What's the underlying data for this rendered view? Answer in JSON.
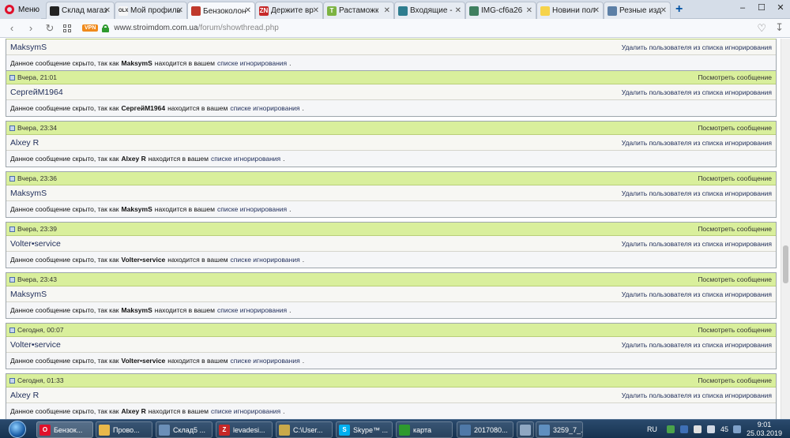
{
  "browser": {
    "menu_label": "Меню",
    "tabs": [
      {
        "label": "Склад магаз",
        "icon": "bookmark-icon",
        "color": "#222222",
        "glyph": ""
      },
      {
        "label": "Мой профиль",
        "icon": "olx-icon",
        "color": "#f7f7f7",
        "glyph": "OLX"
      },
      {
        "label": "Бензоколон",
        "icon": "stroimdom-icon",
        "color": "#c0392b",
        "glyph": ""
      },
      {
        "label": "Держите вр",
        "icon": "zn-icon",
        "color": "#c62828",
        "glyph": "ZN"
      },
      {
        "label": "Растаможк",
        "icon": "t-icon",
        "color": "#7cb342",
        "glyph": "T"
      },
      {
        "label": "Входящие -",
        "icon": "mail-icon",
        "color": "#2e7d8f",
        "glyph": ""
      },
      {
        "label": "IMG-cf6a26",
        "icon": "image-icon",
        "color": "#3f7f5f",
        "glyph": ""
      },
      {
        "label": "Новини пол",
        "icon": "sun-icon",
        "color": "#f6d34a",
        "glyph": ""
      },
      {
        "label": "Резные изд",
        "icon": "carving-icon",
        "color": "#5c7fa6",
        "glyph": ""
      }
    ],
    "new_tab_label": "+",
    "window_controls": [
      "‒",
      "☐",
      "✕"
    ],
    "vpn_badge": "VPN",
    "url_host": "www.stroimdom.com.ua",
    "url_path": "/forum/showthread.php"
  },
  "forum": {
    "view_post_label": "Посмотреть сообщение",
    "unignore_label": "Удалить пользователя из списка игнорирования",
    "hidden_prefix": "Данное сообщение скрыто, так как",
    "hidden_middle": "находится в вашем",
    "ignore_list_link": "списке игнорирования",
    "hidden_suffix": ".",
    "first_partial": {
      "username": "MaksymS"
    },
    "posts": [
      {
        "date": "Вчера, 21:01",
        "username": "СергейМ1964"
      },
      {
        "date": "Вчера, 23:34",
        "username": "Alxey R"
      },
      {
        "date": "Вчера, 23:36",
        "username": "MaksymS"
      },
      {
        "date": "Вчера, 23:39",
        "username": "Volter•service"
      },
      {
        "date": "Вчера, 23:43",
        "username": "MaksymS"
      },
      {
        "date": "Сегодня, 00:07",
        "username": "Volter•service"
      },
      {
        "date": "Сегодня, 01:33",
        "username": "Alxey R"
      }
    ]
  },
  "taskbar": {
    "items": [
      {
        "label": "Бензок...",
        "icon": "opera-icon",
        "color": "#e0102b",
        "glyph": "O"
      },
      {
        "label": "Прово...",
        "icon": "folder-icon",
        "color": "#e8b84a",
        "glyph": ""
      },
      {
        "label": "Склад5 ...",
        "icon": "document-icon",
        "color": "#6b8fb8",
        "glyph": ""
      },
      {
        "label": "levadesi...",
        "icon": "filezilla-icon",
        "color": "#c62828",
        "glyph": "Z"
      },
      {
        "label": "C:\\User...",
        "icon": "explorer-icon",
        "color": "#c9a94a",
        "glyph": ""
      },
      {
        "label": "Skype™ ...",
        "icon": "skype-icon",
        "color": "#00aff0",
        "glyph": "S"
      },
      {
        "label": "карта",
        "icon": "map-icon",
        "color": "#2e9a2e",
        "glyph": ""
      },
      {
        "label": "2017080...",
        "icon": "photo-icon",
        "color": "#4f79a8",
        "glyph": ""
      },
      {
        "label": "",
        "icon": "paint-icon",
        "color": "#8fa7c2",
        "glyph": ""
      },
      {
        "label": "3259_7_...",
        "icon": "viewer-icon",
        "color": "#5f8fbf",
        "glyph": ""
      }
    ],
    "lang": "RU",
    "tray_number": "45",
    "time": "9:01",
    "date": "25.03.2019"
  }
}
